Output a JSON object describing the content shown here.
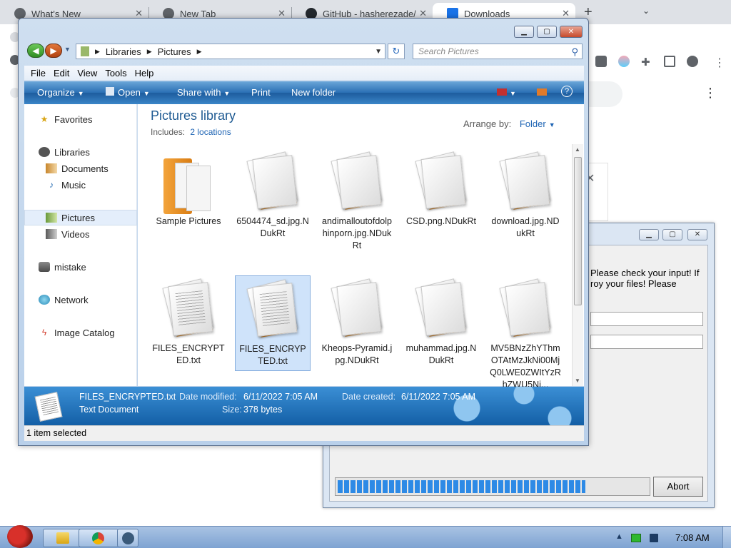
{
  "browser": {
    "tabs": [
      {
        "title": "What's New"
      },
      {
        "title": "New Tab"
      },
      {
        "title": "GitHub - hasherezade/"
      },
      {
        "title": "Downloads"
      }
    ],
    "new_tab_symbol": "+",
    "close_symbol": "✕"
  },
  "explorer": {
    "breadcrumb": [
      "Libraries",
      "Pictures"
    ],
    "search_placeholder": "Search Pictures",
    "menu": [
      "File",
      "Edit",
      "View",
      "Tools",
      "Help"
    ],
    "commands": {
      "organize": "Organize",
      "open": "Open",
      "share_with": "Share with",
      "print": "Print",
      "new_folder": "New folder"
    },
    "nav": {
      "favorites": "Favorites",
      "libraries": "Libraries",
      "documents": "Documents",
      "music": "Music",
      "pictures": "Pictures",
      "videos": "Videos",
      "user": "mistake",
      "network": "Network",
      "image_catalog": "Image Catalog"
    },
    "library_title": "Pictures library",
    "includes_label": "Includes:",
    "includes_link": "2 locations",
    "arrange_label": "Arrange by:",
    "arrange_value": "Folder",
    "files": [
      {
        "name": "Sample Pictures",
        "kind": "folder"
      },
      {
        "name": "6504474_sd.jpg.NDukRt",
        "kind": "blank"
      },
      {
        "name": "andimalloutofdolphinporn.jpg.NDukRt",
        "kind": "blank"
      },
      {
        "name": "CSD.png.NDukRt",
        "kind": "blank"
      },
      {
        "name": "download.jpg.NDukRt",
        "kind": "blank"
      },
      {
        "name": "FILES_ENCRYPTED.txt",
        "kind": "text"
      },
      {
        "name": "FILES_ENCRYPTED.txt",
        "kind": "text"
      },
      {
        "name": "Kheops-Pyramid.jpg.NDukRt",
        "kind": "blank"
      },
      {
        "name": "muhammad.jpg.NDukRt",
        "kind": "blank"
      },
      {
        "name": "MV5BNzZhYThmOTAtMzJkNi00MjQ0LWE0ZWItYzRhZWU5Nj...",
        "kind": "blank"
      }
    ],
    "selected_index": 6,
    "details": {
      "filename": "FILES_ENCRYPTED.txt",
      "type": "Text Document",
      "modified_label": "Date modified:",
      "modified_value": "6/11/2022 7:05 AM",
      "created_label": "Date created:",
      "created_value": "6/11/2022 7:05 AM",
      "size_label": "Size:",
      "size_value": "378 bytes"
    },
    "status": "1 item selected"
  },
  "ransom_dialog": {
    "message": "Please check your input! If\nroy your files! Please",
    "progress_fraction": 0.8,
    "abort_label": "Abort"
  },
  "taskbar": {
    "clock": "7:08 AM"
  },
  "colors": {
    "accent_blue": "#1e5a92",
    "link_blue": "#1e64b4",
    "progress_blue": "#2d8ae6",
    "chrome_tabstrip": "#dee1e6"
  }
}
